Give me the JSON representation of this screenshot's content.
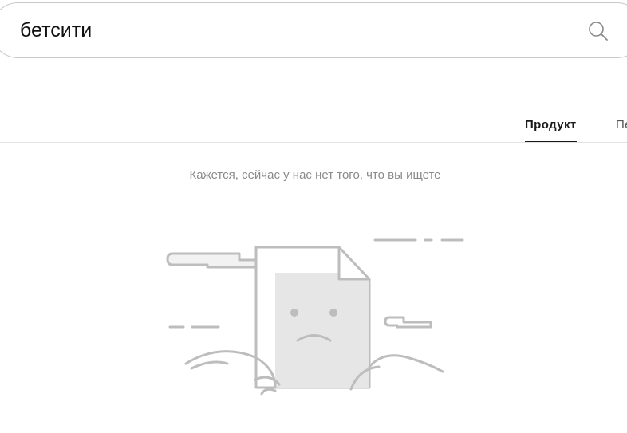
{
  "search": {
    "value": "бетсити"
  },
  "tabs": [
    {
      "label": "Продукт",
      "active": true
    },
    {
      "label": "Пе",
      "active": false
    }
  ],
  "empty_state": {
    "message": "Кажется, сейчас у нас нет того, что вы ищете"
  },
  "icons": {
    "search": "search-icon",
    "illustration": "sad-document-icon"
  },
  "colors": {
    "text": "#111111",
    "muted": "#8a8a8a",
    "border": "#c8c8c8",
    "illustration_stroke": "#bdbdbd",
    "illustration_fill": "#e6e6e6"
  }
}
